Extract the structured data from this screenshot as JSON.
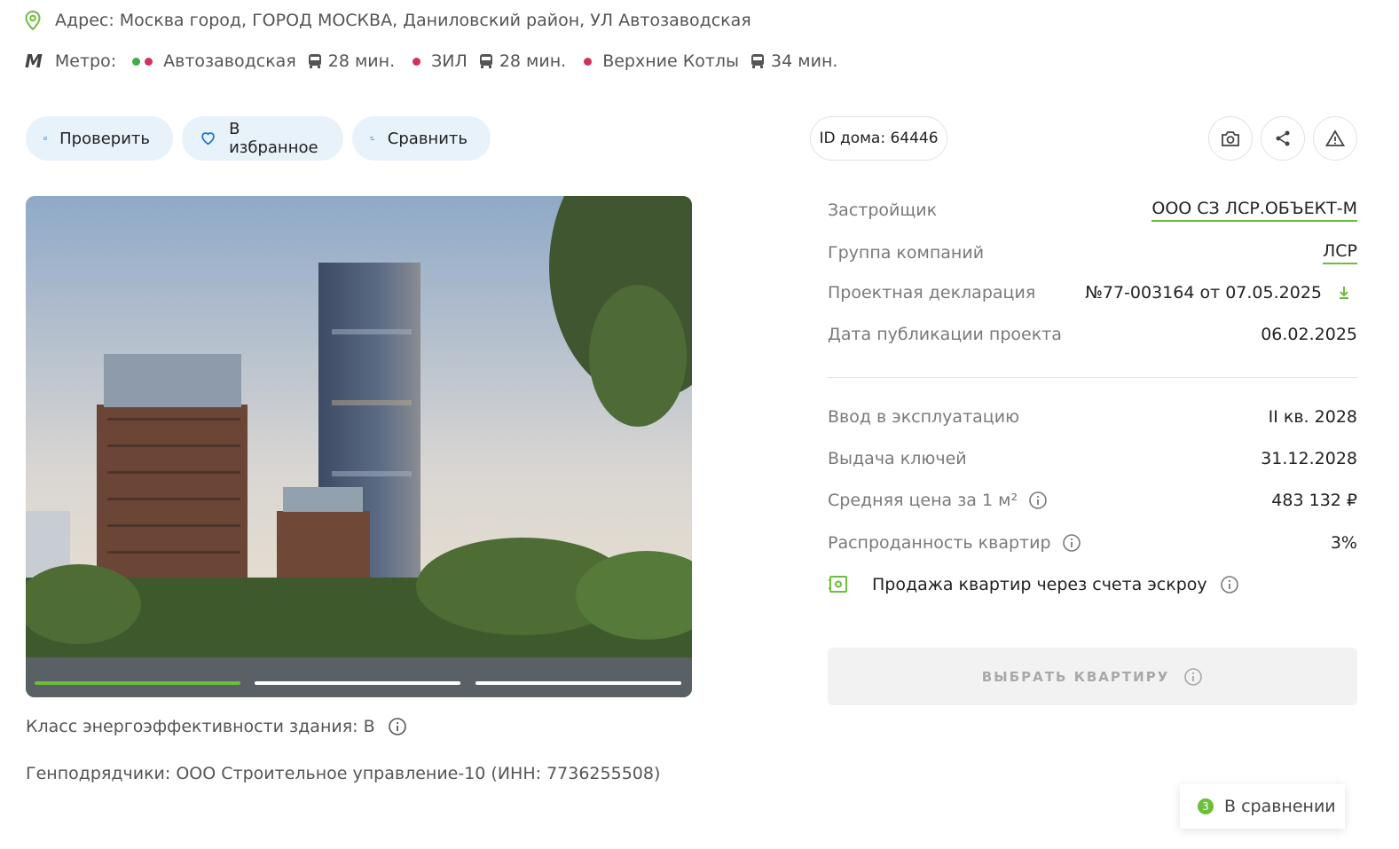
{
  "address": {
    "label": "Адрес: Москва город, ГОРОД МОСКВА, Даниловский район, УЛ Автозаводская"
  },
  "metro": {
    "label": "Метро:",
    "stations": [
      {
        "name": "Автозаводская",
        "time": "28 мин.",
        "colors": [
          "#3fae49",
          "#d2325e"
        ]
      },
      {
        "name": "ЗИЛ",
        "time": "28 мин.",
        "colors": [
          "#d2325e"
        ]
      },
      {
        "name": "Верхние Котлы",
        "time": "34 мин.",
        "colors": [
          "#d2325e"
        ]
      }
    ]
  },
  "actions": {
    "check": "Проверить",
    "favorite": "В избранное",
    "compare": "Сравнить"
  },
  "house_id": "ID дома: 64446",
  "info": {
    "developer_label": "Застройщик",
    "developer_value": "ООО СЗ ЛСР.ОБЪЕКТ-М",
    "group_label": "Группа компаний",
    "group_value": "ЛСР",
    "declaration_label": "Проектная декларация",
    "declaration_value": "№77-003164 от 07.05.2025",
    "published_label": "Дата публикации проекта",
    "published_value": "06.02.2025",
    "commission_label": "Ввод в эксплуатацию",
    "commission_value": "II кв. 2028",
    "keys_label": "Выдача ключей",
    "keys_value": "31.12.2028",
    "price_label": "Средняя цена за 1 м²",
    "price_value": "483 132 ₽",
    "sold_label": "Распроданность квартир",
    "sold_value": "3%",
    "escrow_label": "Продажа квартир через счета эскроу"
  },
  "choose_button": "ВЫБРАТЬ КВАРТИРУ",
  "gallery": {
    "slides_total": 3,
    "active_slide": 1
  },
  "energy": "Класс энергоэффективности здания: В",
  "contractors": "Генподрядчики: ООО Строительное управление-10 (ИНН: 7736255508)",
  "compare_badge": {
    "count": "3",
    "label": "В сравнении"
  },
  "colors": {
    "accent": "#6bbf3b",
    "pill_bg": "#e8f2fb",
    "pill_icon": "#1e78c8",
    "metro_red": "#d2325e",
    "metro_green": "#3fae49"
  }
}
